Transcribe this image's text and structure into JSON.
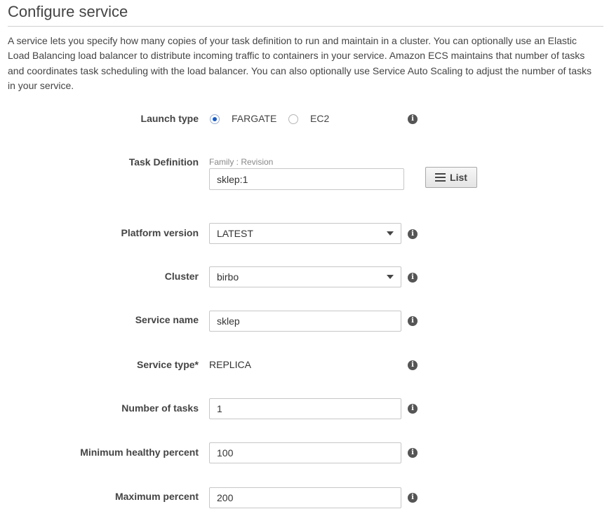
{
  "page": {
    "title": "Configure service",
    "description": "A service lets you specify how many copies of your task definition to run and maintain in a cluster. You can optionally use an Elastic Load Balancing load balancer to distribute incoming traffic to containers in your service. Amazon ECS maintains that number of tasks and coordinates task scheduling with the load balancer. You can also optionally use Service Auto Scaling to adjust the number of tasks in your service."
  },
  "launch_type": {
    "label": "Launch type",
    "options": [
      {
        "label": "FARGATE",
        "selected": true
      },
      {
        "label": "EC2",
        "selected": false
      }
    ]
  },
  "task_definition": {
    "label": "Task Definition",
    "hint": "Family : Revision",
    "value": "sklep:1",
    "list_button": "List"
  },
  "platform_version": {
    "label": "Platform version",
    "value": "LATEST"
  },
  "cluster": {
    "label": "Cluster",
    "value": "birbo"
  },
  "service_name": {
    "label": "Service name",
    "value": "sklep"
  },
  "service_type": {
    "label": "Service type*",
    "value": "REPLICA"
  },
  "number_of_tasks": {
    "label": "Number of tasks",
    "value": "1"
  },
  "min_healthy_percent": {
    "label": "Minimum healthy percent",
    "value": "100"
  },
  "max_percent": {
    "label": "Maximum percent",
    "value": "200"
  },
  "icons": {
    "info": "info-icon",
    "dropdown": "caret-down-icon",
    "list": "list-icon"
  },
  "info_glyph": "i",
  "colors": {
    "radio_selected": "#1a5cc4",
    "info_icon": "#555555",
    "button_border": "#a8a8a8"
  }
}
